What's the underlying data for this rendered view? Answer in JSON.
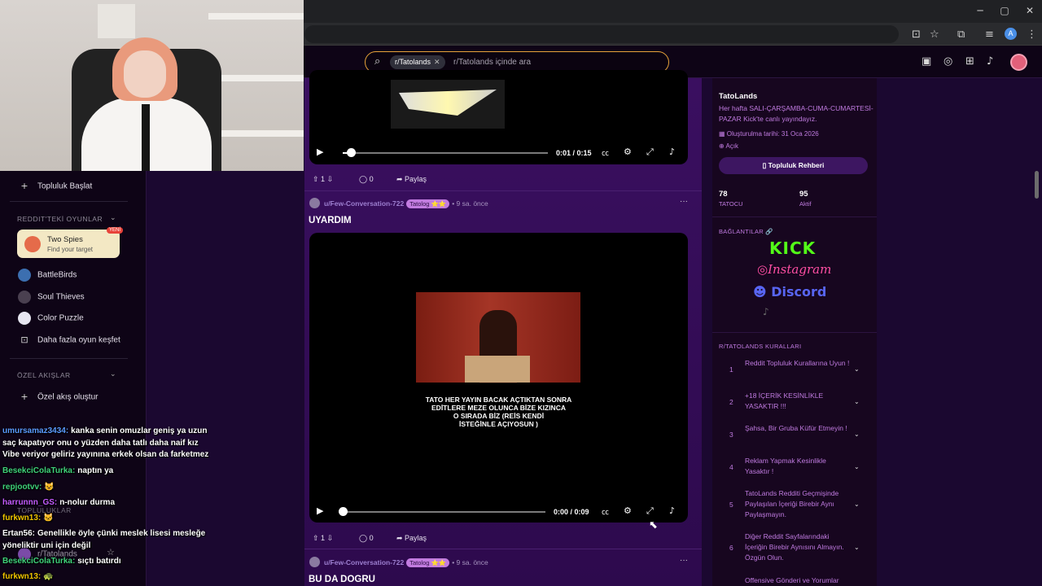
{
  "browser": {
    "window_controls": [
      "─",
      "▢",
      "✕"
    ],
    "toolbar_icons": [
      "install-icon",
      "star-icon",
      "extensions-icon",
      "media-icon"
    ],
    "profile_initial": "A"
  },
  "header": {
    "search_chip": "r/Tatolands",
    "search_placeholder": "r/Tatolands içinde ara"
  },
  "left_sidebar": {
    "start_community": "Topluluk Başlat",
    "games_heading": "REDDIT'TEKİ OYUNLAR",
    "featured_game": {
      "title": "Two Spies",
      "subtitle": "Find your target",
      "badge": "YENİ"
    },
    "games": [
      "BattleBirds",
      "Soul Thieves",
      "Color Puzzle"
    ],
    "more_games": "Daha fazla oyun keşfet",
    "feeds_heading": "ÖZEL AKIŞLAR",
    "create_feed": "Özel akış oluştur",
    "communities_heading": "TOPLULUKLAR",
    "community": "r/Tatolands"
  },
  "chat": [
    {
      "user": "umursamaz3434:",
      "user_color": "#5b9bff",
      "msg": "kanka senin omuzlar geniş ya uzun"
    },
    {
      "user": "",
      "user_color": "#ffffff",
      "msg": "saç kapatıyor onu o yüzden daha tatlı daha naif kız"
    },
    {
      "user": "",
      "user_color": "#ffffff",
      "msg": "Vibe veriyor geliriz yayınına erkek olsan da farketmez"
    },
    {
      "user": "BesekciColaTurka:",
      "user_color": "#3fd17a",
      "msg": "naptın ya"
    },
    {
      "user": "repjootvv:",
      "user_color": "#3fd17a",
      "msg": "😺"
    },
    {
      "user": "harrunnn_GS:",
      "user_color": "#c45bff",
      "msg": "n-nolur durma"
    },
    {
      "user": "furkwn13:",
      "user_color": "#f0c400",
      "msg": "🐱"
    },
    {
      "user": "Ertan56:",
      "user_color": "#ffffff",
      "msg": "Genellikle öyle çünki meslek lisesi mesleğe"
    },
    {
      "user": "",
      "user_color": "#ffffff",
      "msg": "yöneliktir uni için değil"
    },
    {
      "user": "BesekciColaTurka:",
      "user_color": "#3fd17a",
      "msg": "sıçtı batırdı"
    },
    {
      "user": "furkwn13:",
      "user_color": "#f0c400",
      "msg": "🐢"
    }
  ],
  "feed": {
    "post1": {
      "time": "0:01 / 0:15",
      "progress": 0.04,
      "votes": "1",
      "comments": "0",
      "share": "Paylaş"
    },
    "post2": {
      "author": "u/Few-Conversation-722",
      "flair": "Tatolog ⭐⭐",
      "age": "• 9 sa. önce",
      "title": "UYARDIM",
      "caption": [
        "TATO HER YAYIN BACAK AÇTIKTAN SONRA",
        "EDİTLERE MEZE OLUNCA BİZE KIZINCA",
        "O SIRADA BİZ (REİS KENDİ",
        "İSTEĞİNLE AÇIYOSUN )"
      ],
      "time": "0:00 / 0:09",
      "progress": 0.0,
      "votes": "1",
      "comments": "0",
      "share": "Paylaş"
    },
    "post3": {
      "author": "u/Few-Conversation-722",
      "flair": "Tatolog ⭐⭐",
      "age": "• 9 sa. önce",
      "title": "BU DA DOGRU"
    }
  },
  "right_sidebar": {
    "name": "TatoLands",
    "description": "Her hafta SALI-ÇARŞAMBA-CUMA-CUMARTESİ-PAZAR Kick'te canlı yayındayız.",
    "created": "Oluşturulma tarihi: 31 Oca 2026",
    "visibility": "Açık",
    "guide_button": "Topluluk Rehberi",
    "members_count": "78",
    "members_label": "TATOCU",
    "online_count": "95",
    "online_label": "Aktif",
    "links_heading": "BAĞLANTILAR 🔗",
    "links": [
      "KICK",
      "Instagram",
      "Discord"
    ],
    "rules_heading": "R/TATOLANDS KURALLARI",
    "rules": [
      {
        "n": "1",
        "text": "Reddit Topluluk Kurallarına Uyun !"
      },
      {
        "n": "2",
        "text": "+18 İÇERİK KESİNLİKLE YASAKTIR !!!"
      },
      {
        "n": "3",
        "text": "Şahsa, Bir Gruba Küfür Etmeyin !"
      },
      {
        "n": "4",
        "text": "Reklam Yapmak Kesinlikle Yasaktır !"
      },
      {
        "n": "5",
        "text": "TatoLands Redditi Geçmişinde Paylaşılan İçeriği Birebir Aynı Paylaşmayın."
      },
      {
        "n": "6",
        "text": "Diğer Reddit Sayfalarındaki İçeriğin Birebir Aynısını Almayın. Özgün Olun."
      },
      {
        "n": "",
        "text": "Offensive Gönderi ve Yorumlar"
      }
    ]
  }
}
